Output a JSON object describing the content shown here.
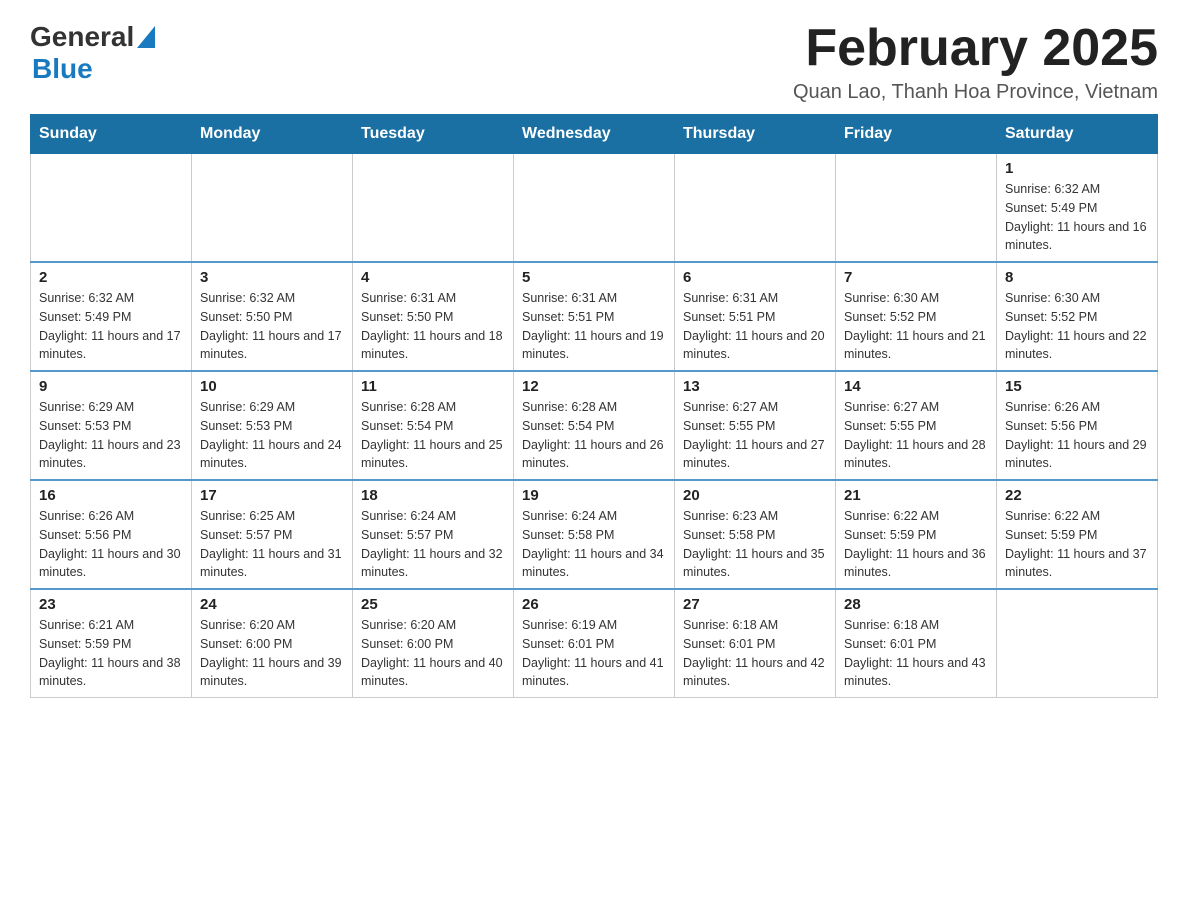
{
  "header": {
    "logo_general": "General",
    "logo_blue": "Blue",
    "month_year": "February 2025",
    "location": "Quan Lao, Thanh Hoa Province, Vietnam"
  },
  "days_of_week": [
    "Sunday",
    "Monday",
    "Tuesday",
    "Wednesday",
    "Thursday",
    "Friday",
    "Saturday"
  ],
  "weeks": [
    {
      "days": [
        {
          "date": "",
          "info": ""
        },
        {
          "date": "",
          "info": ""
        },
        {
          "date": "",
          "info": ""
        },
        {
          "date": "",
          "info": ""
        },
        {
          "date": "",
          "info": ""
        },
        {
          "date": "",
          "info": ""
        },
        {
          "date": "1",
          "info": "Sunrise: 6:32 AM\nSunset: 5:49 PM\nDaylight: 11 hours and 16 minutes."
        }
      ]
    },
    {
      "days": [
        {
          "date": "2",
          "info": "Sunrise: 6:32 AM\nSunset: 5:49 PM\nDaylight: 11 hours and 17 minutes."
        },
        {
          "date": "3",
          "info": "Sunrise: 6:32 AM\nSunset: 5:50 PM\nDaylight: 11 hours and 17 minutes."
        },
        {
          "date": "4",
          "info": "Sunrise: 6:31 AM\nSunset: 5:50 PM\nDaylight: 11 hours and 18 minutes."
        },
        {
          "date": "5",
          "info": "Sunrise: 6:31 AM\nSunset: 5:51 PM\nDaylight: 11 hours and 19 minutes."
        },
        {
          "date": "6",
          "info": "Sunrise: 6:31 AM\nSunset: 5:51 PM\nDaylight: 11 hours and 20 minutes."
        },
        {
          "date": "7",
          "info": "Sunrise: 6:30 AM\nSunset: 5:52 PM\nDaylight: 11 hours and 21 minutes."
        },
        {
          "date": "8",
          "info": "Sunrise: 6:30 AM\nSunset: 5:52 PM\nDaylight: 11 hours and 22 minutes."
        }
      ]
    },
    {
      "days": [
        {
          "date": "9",
          "info": "Sunrise: 6:29 AM\nSunset: 5:53 PM\nDaylight: 11 hours and 23 minutes."
        },
        {
          "date": "10",
          "info": "Sunrise: 6:29 AM\nSunset: 5:53 PM\nDaylight: 11 hours and 24 minutes."
        },
        {
          "date": "11",
          "info": "Sunrise: 6:28 AM\nSunset: 5:54 PM\nDaylight: 11 hours and 25 minutes."
        },
        {
          "date": "12",
          "info": "Sunrise: 6:28 AM\nSunset: 5:54 PM\nDaylight: 11 hours and 26 minutes."
        },
        {
          "date": "13",
          "info": "Sunrise: 6:27 AM\nSunset: 5:55 PM\nDaylight: 11 hours and 27 minutes."
        },
        {
          "date": "14",
          "info": "Sunrise: 6:27 AM\nSunset: 5:55 PM\nDaylight: 11 hours and 28 minutes."
        },
        {
          "date": "15",
          "info": "Sunrise: 6:26 AM\nSunset: 5:56 PM\nDaylight: 11 hours and 29 minutes."
        }
      ]
    },
    {
      "days": [
        {
          "date": "16",
          "info": "Sunrise: 6:26 AM\nSunset: 5:56 PM\nDaylight: 11 hours and 30 minutes."
        },
        {
          "date": "17",
          "info": "Sunrise: 6:25 AM\nSunset: 5:57 PM\nDaylight: 11 hours and 31 minutes."
        },
        {
          "date": "18",
          "info": "Sunrise: 6:24 AM\nSunset: 5:57 PM\nDaylight: 11 hours and 32 minutes."
        },
        {
          "date": "19",
          "info": "Sunrise: 6:24 AM\nSunset: 5:58 PM\nDaylight: 11 hours and 34 minutes."
        },
        {
          "date": "20",
          "info": "Sunrise: 6:23 AM\nSunset: 5:58 PM\nDaylight: 11 hours and 35 minutes."
        },
        {
          "date": "21",
          "info": "Sunrise: 6:22 AM\nSunset: 5:59 PM\nDaylight: 11 hours and 36 minutes."
        },
        {
          "date": "22",
          "info": "Sunrise: 6:22 AM\nSunset: 5:59 PM\nDaylight: 11 hours and 37 minutes."
        }
      ]
    },
    {
      "days": [
        {
          "date": "23",
          "info": "Sunrise: 6:21 AM\nSunset: 5:59 PM\nDaylight: 11 hours and 38 minutes."
        },
        {
          "date": "24",
          "info": "Sunrise: 6:20 AM\nSunset: 6:00 PM\nDaylight: 11 hours and 39 minutes."
        },
        {
          "date": "25",
          "info": "Sunrise: 6:20 AM\nSunset: 6:00 PM\nDaylight: 11 hours and 40 minutes."
        },
        {
          "date": "26",
          "info": "Sunrise: 6:19 AM\nSunset: 6:01 PM\nDaylight: 11 hours and 41 minutes."
        },
        {
          "date": "27",
          "info": "Sunrise: 6:18 AM\nSunset: 6:01 PM\nDaylight: 11 hours and 42 minutes."
        },
        {
          "date": "28",
          "info": "Sunrise: 6:18 AM\nSunset: 6:01 PM\nDaylight: 11 hours and 43 minutes."
        },
        {
          "date": "",
          "info": ""
        }
      ]
    }
  ]
}
